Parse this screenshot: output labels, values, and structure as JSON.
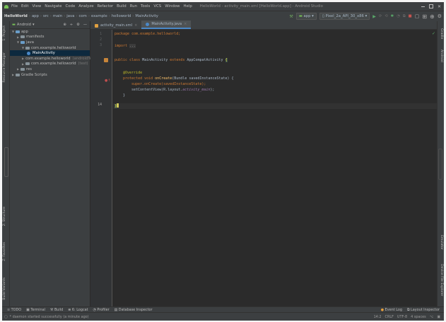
{
  "menu": {
    "app_icon": "android-icon",
    "items": [
      "File",
      "Edit",
      "View",
      "Navigate",
      "Code",
      "Analyze",
      "Refactor",
      "Build",
      "Run",
      "Tools",
      "VCS",
      "Window",
      "Help"
    ],
    "window_title": "HelloWorld - activity_main.xml [HelloWorld.app] - Android Studio"
  },
  "nav": {
    "breadcrumbs": [
      "HelloWorld",
      "app",
      "src",
      "main",
      "java",
      "com",
      "example",
      "helloworld",
      "MainActivity"
    ],
    "run_config": "app",
    "device": "Pixel_2a_API_30_x86",
    "accent": "#4a88c7"
  },
  "left_tools": [
    "1: Project",
    "Resource Manager",
    "2: Structure",
    "Z: Favorites",
    "Build Variants"
  ],
  "right_tools": [
    "Gradle",
    "Android",
    "Emulator",
    "Device File Explorer"
  ],
  "project": {
    "view_label": "Android",
    "tree": [
      {
        "label": "app",
        "indent": 0,
        "expanded": true,
        "blue": true
      },
      {
        "label": "manifests",
        "indent": 1,
        "expanded": false
      },
      {
        "label": "java",
        "indent": 1,
        "expanded": true,
        "blue": true
      },
      {
        "label": "com.example.helloworld",
        "indent": 2,
        "expanded": true
      },
      {
        "label": "MainActivity",
        "indent": 3,
        "selected": true,
        "class": true
      },
      {
        "label": "com.example.helloworld",
        "indent": 2,
        "expanded": false,
        "suffix": "(androidTest)"
      },
      {
        "label": "com.example.helloworld",
        "indent": 2,
        "expanded": false,
        "suffix": "(test)"
      },
      {
        "label": "res",
        "indent": 1,
        "expanded": false
      },
      {
        "label": "Gradle Scripts",
        "indent": 0,
        "expanded": false
      }
    ]
  },
  "editor": {
    "tabs": [
      {
        "label": "activity_main.xml",
        "active": false,
        "icon": "xml-file-icon"
      },
      {
        "label": "MainActivity.java",
        "active": true,
        "icon": "class-icon"
      }
    ],
    "line_numbers": [
      "1",
      "2",
      "3",
      "",
      "",
      "",
      "",
      "",
      "",
      "",
      "",
      "",
      "",
      "14"
    ],
    "code": {
      "l1": "package com.example.helloworld;",
      "l3_kw": "import",
      "l3_fold": "...",
      "l7_public": "public",
      "l7_class": "class",
      "l7_name": "MainActivity",
      "l7_extends": "extends",
      "l7_super": "AppCompatActivity",
      "l9_annotation": "@Override",
      "l10_protected": "protected",
      "l10_void": "void",
      "l10_method": "onCreate",
      "l10_params": "(Bundle savedInstanceState) {",
      "l11": "super.onCreate(savedInstanceState);",
      "l12_a": "setContentView(R.layout.",
      "l12_field": "activity_main",
      "l12_b": ");",
      "l13": "}",
      "l14": "}"
    }
  },
  "bottom_tabs": [
    "TODO",
    "Terminal",
    "Build",
    "6: Logcat",
    "Profiler",
    "Database Inspector"
  ],
  "bottom_right_tabs": [
    "Event Log",
    "Layout Inspector"
  ],
  "status": {
    "message": "* daemon started successfully (a minute ago)",
    "position": "14:2",
    "line_sep": "CRLF",
    "encoding": "UTF-8",
    "indent": "4 spaces"
  }
}
